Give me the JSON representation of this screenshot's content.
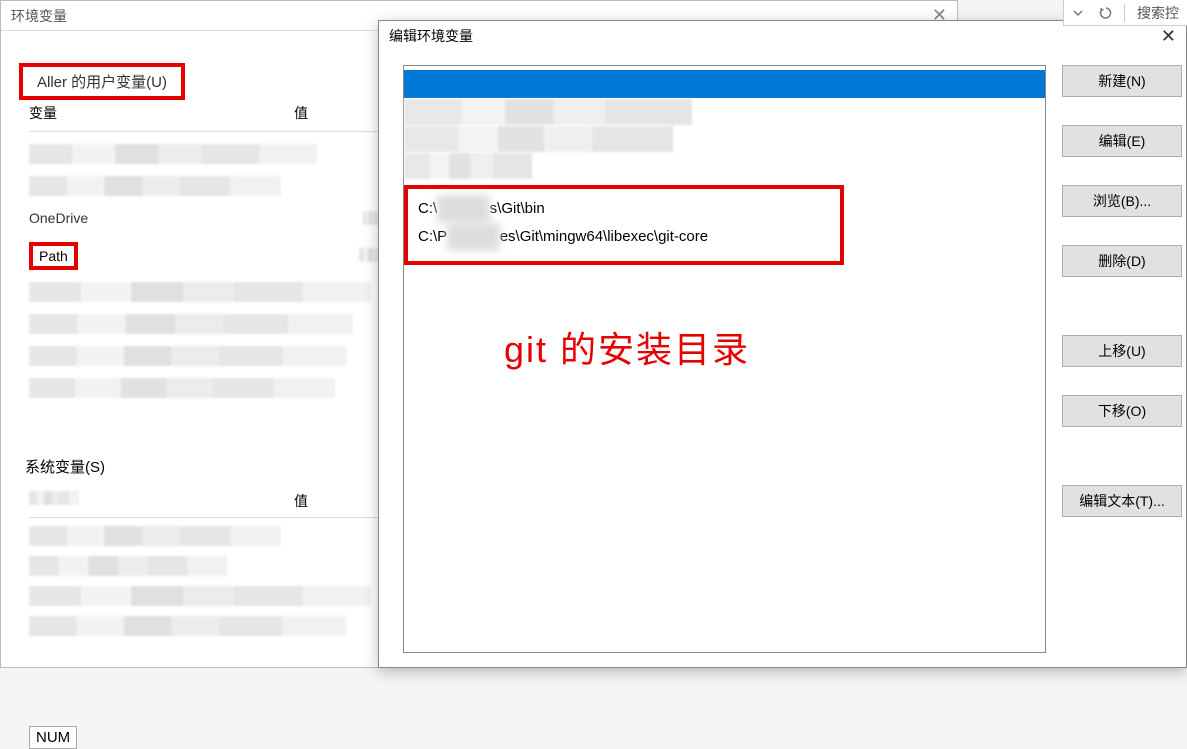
{
  "toolbar": {
    "search_label": "搜索控"
  },
  "back_dialog": {
    "title": "环境变量",
    "user_section_label": "Aller 的用户变量(U)",
    "col_variable": "变量",
    "col_value": "值",
    "onedrive_label": "OneDrive",
    "path_label": "Path",
    "sys_section_label": "系统变量(S)",
    "num_label": "NUM"
  },
  "front_dialog": {
    "title": "编辑环境变量",
    "paths": {
      "line1_prefix": "C:\\",
      "line1_mid_blur": "xxxxxxx",
      "line1_suffix": "s\\Git\\bin",
      "line2_prefix": "C:\\P",
      "line2_mid_blur": "xxxxxxx",
      "line2_suffix": "es\\Git\\mingw64\\libexec\\git-core"
    },
    "annotation": "git 的安装目录",
    "buttons": {
      "new": "新建(N)",
      "edit": "编辑(E)",
      "browse": "浏览(B)...",
      "delete": "删除(D)",
      "move_up": "上移(U)",
      "move_down": "下移(O)",
      "edit_text": "编辑文本(T)..."
    }
  }
}
